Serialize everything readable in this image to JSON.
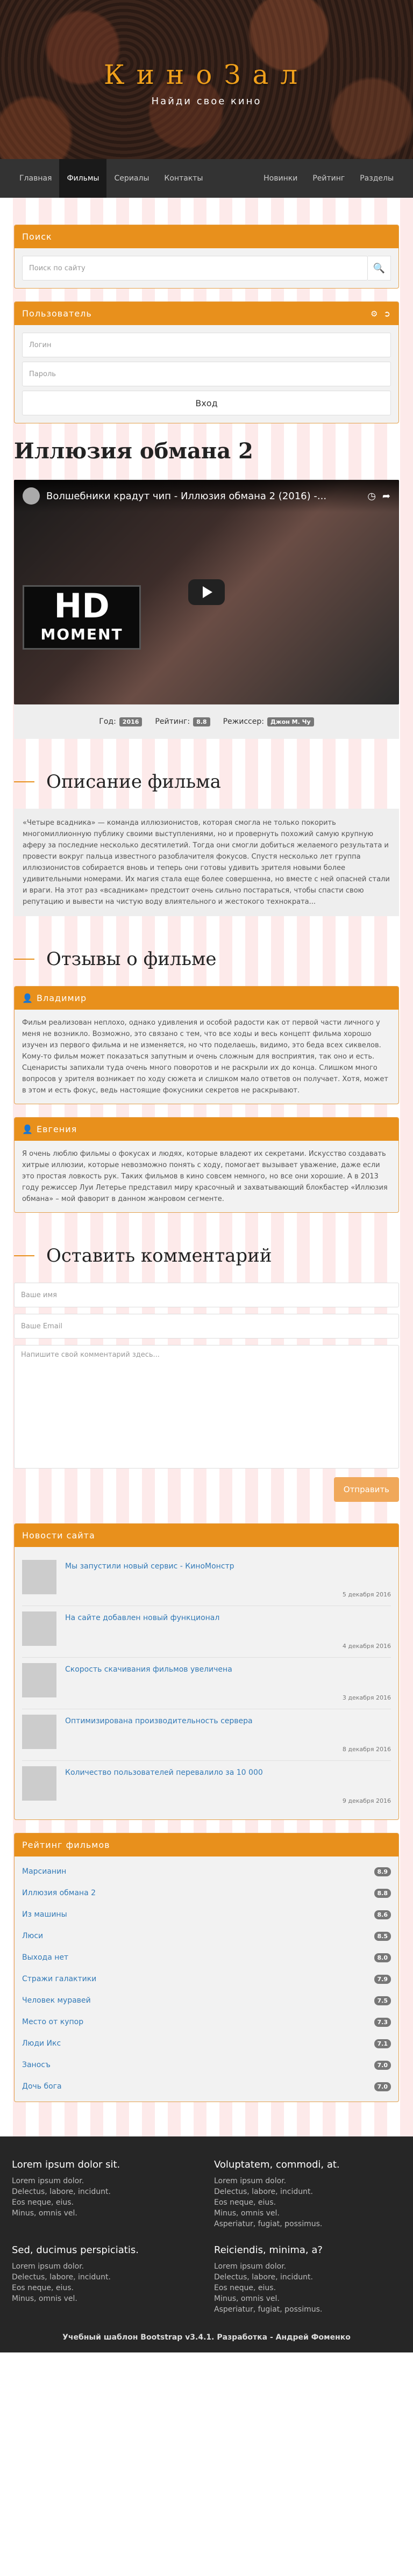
{
  "header": {
    "brand": "КиноЗал",
    "tagline": "Найди свое кино"
  },
  "nav": {
    "left": [
      "Главная",
      "Фильмы",
      "Сериалы",
      "Контакты"
    ],
    "active": "Фильмы",
    "right": [
      "Новинки",
      "Рейтинг",
      "Разделы"
    ]
  },
  "search": {
    "heading": "Поиск",
    "placeholder": "Поиск по сайту"
  },
  "user": {
    "heading": "Пользователь",
    "login_placeholder": "Логин",
    "password_placeholder": "Пароль",
    "submit": "Вход"
  },
  "film": {
    "title": "Иллюзия обмана 2",
    "video_title": "Волшебники крадут чип - Иллюзия обмана 2 (2016) -...",
    "badge_top": "HD",
    "badge_bottom": "MOMENT",
    "year_label": "Год:",
    "year": "2016",
    "rating_label": "Рейтинг:",
    "rating": "8.8",
    "director_label": "Режиссер:",
    "director": "Джон М. Чу"
  },
  "description": {
    "heading": "Описание фильма",
    "text": "«Четыре всадника» — команда иллюзионистов, которая смогла не только покорить многомиллионную публику своими выступлениями, но и провернуть похожий самую крупную аферу за последние несколько десятилетий. Тогда они смогли добиться желаемого результата и провести вокруг пальца известного разоблачителя фокусов. Спустя несколько лет группа иллюзионистов собирается вновь и теперь они готовы удивить зрителя новыми более удивительными номерами. Их магия стала еще более совершенна, но вместе с ней опасней стали и враги. На этот раз «всадникам» предстоит очень сильно постараться, чтобы спасти свою репутацию и вывести на чистую воду влиятельного и жестокого технократа..."
  },
  "reviews": {
    "heading": "Отзывы о фильме",
    "items": [
      {
        "author": "Владимир",
        "text": "Фильм реализован неплохо, однако удивления и особой радости как от первой части личного у меня не возникло. Возможно, это связано с тем, что все ходы и весь концепт фильма хорошо изучен из первого фильма и не изменяется, но что поделаешь, видимо, это беда всех сиквелов. Кому-то фильм может показаться запутным и очень сложным для восприятия, так оно и есть. Сценаристы запихали туда очень много поворотов и не раскрыли их до конца. Слишком много вопросов у зрителя возникает по ходу сюжета и слишком мало ответов он получает. Хотя, может в этом и есть фокус, ведь настоящие фокусники секретов не раскрывают."
      },
      {
        "author": "Евгения",
        "text": "Я очень люблю фильмы о фокусах и людях, которые владеют их секретами. Искусство создавать хитрые иллюзии, которые невозможно понять с ходу, помогает вызывает уважение, даже если это простая ловкость рук. Таких фильмов в кино совсем немного, но все они хорошие. А в 2013 году режиссер Луи Летерье представил миру красочный и захватывающий блокбастер «Иллюзия обмана» – мой фаворит в данном жанровом сегменте."
      }
    ]
  },
  "comment": {
    "heading": "Оставить комментарий",
    "name_placeholder": "Ваше имя",
    "email_placeholder": "Ваше Email",
    "text_placeholder": "Напишите свой комментарий здесь...",
    "submit": "Отправить"
  },
  "news": {
    "heading": "Новости сайта",
    "items": [
      {
        "title": "Мы запустили новый сервис - КиноМонстр",
        "date": "5 декабря 2016"
      },
      {
        "title": "На сайте добавлен новый функционал",
        "date": "4 декабря 2016"
      },
      {
        "title": "Скорость скачивания фильмов увеличена",
        "date": "3 декабря 2016"
      },
      {
        "title": "Оптимизирована производительность сервера",
        "date": "8 декабря 2016"
      },
      {
        "title": "Количество пользователей перевалило за 10 000",
        "date": "9 декабря 2016"
      }
    ]
  },
  "ratings": {
    "heading": "Рейтинг фильмов",
    "items": [
      {
        "name": "Марсианин",
        "value": "8.9"
      },
      {
        "name": "Иллюзия обмана 2",
        "value": "8.8"
      },
      {
        "name": "Из машины",
        "value": "8.6"
      },
      {
        "name": "Люси",
        "value": "8.5"
      },
      {
        "name": "Выхода нет",
        "value": "8.0"
      },
      {
        "name": "Стражи галактики",
        "value": "7.9"
      },
      {
        "name": "Человек муравей",
        "value": "7.5"
      },
      {
        "name": "Место от купор",
        "value": "7.3"
      },
      {
        "name": "Люди Икс",
        "value": "7.1"
      },
      {
        "name": "Заносъ",
        "value": "7.0"
      },
      {
        "name": "Дочь бога",
        "value": "7.0"
      }
    ]
  },
  "footer": {
    "columns": [
      {
        "title": "Lorem ipsum dolor sit.",
        "links": [
          "Lorem ipsum dolor.",
          "Delectus, labore, incidunt.",
          "Eos neque, eius.",
          "Minus, omnis vel."
        ]
      },
      {
        "title": "Voluptatem, commodi, at.",
        "links": [
          "Lorem ipsum dolor.",
          "Delectus, labore, incidunt.",
          "Eos neque, eius.",
          "Minus, omnis vel.",
          "Asperiatur, fugiat, possimus."
        ]
      },
      {
        "title": "Sed, ducimus perspiciatis.",
        "links": [
          "Lorem ipsum dolor.",
          "Delectus, labore, incidunt.",
          "Eos neque, eius.",
          "Minus, omnis vel."
        ]
      },
      {
        "title": "Reiciendis, minima, a?",
        "links": [
          "Lorem ipsum dolor.",
          "Delectus, labore, incidunt.",
          "Eos neque, eius.",
          "Minus, omnis vel.",
          "Asperiatur, fugiat, possimus."
        ]
      }
    ],
    "copyright": "Учебный шаблон Bootstrap v3.4.1. Разработка - Андрей Фоменко"
  },
  "colors": {
    "accent": "#e8901c",
    "nav_bg": "#333333",
    "footer_bg": "#262626",
    "link": "#337ab7"
  }
}
